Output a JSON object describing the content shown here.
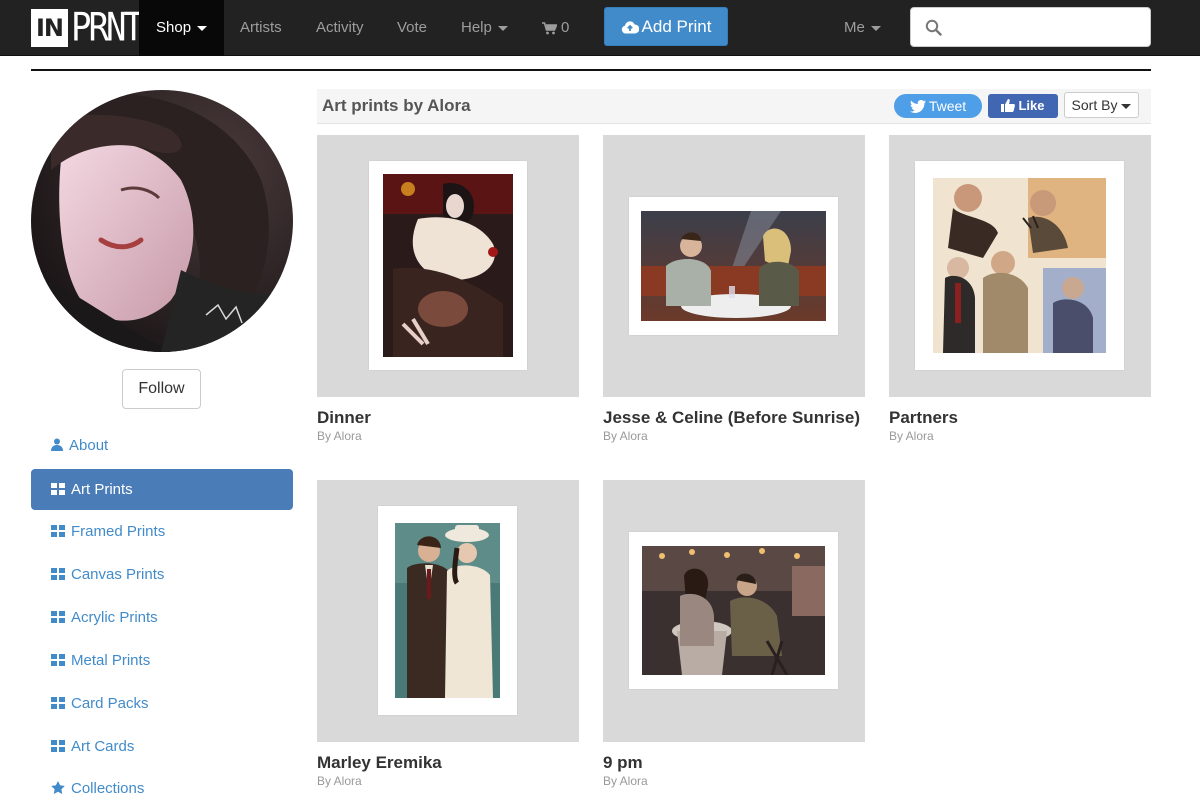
{
  "brand": {
    "logo_box": "IN",
    "logo_word": "PRNT"
  },
  "nav": {
    "shop": "Shop",
    "artists": "Artists",
    "activity": "Activity",
    "vote": "Vote",
    "help": "Help",
    "cart_count": "0",
    "add_print": "Add Print",
    "me": "Me",
    "search_placeholder": ""
  },
  "profile": {
    "follow": "Follow"
  },
  "sidebar": {
    "items": [
      {
        "label": "About",
        "icon": "user-icon",
        "active": false
      },
      {
        "label": "Art Prints",
        "icon": "grid-icon",
        "active": true
      },
      {
        "label": "Framed Prints",
        "icon": "grid-icon",
        "active": false
      },
      {
        "label": "Canvas Prints",
        "icon": "grid-icon",
        "active": false
      },
      {
        "label": "Acrylic Prints",
        "icon": "grid-icon",
        "active": false
      },
      {
        "label": "Metal Prints",
        "icon": "grid-icon",
        "active": false
      },
      {
        "label": "Card Packs",
        "icon": "grid-icon",
        "active": false
      },
      {
        "label": "Art Cards",
        "icon": "grid-icon",
        "active": false
      },
      {
        "label": "Collections",
        "icon": "star-icon",
        "active": false
      }
    ]
  },
  "main": {
    "title": "Art prints by Alora",
    "tweet": "Tweet",
    "like": "Like",
    "sort": "Sort By"
  },
  "prints": [
    {
      "title": "Dinner",
      "by": "By Alora"
    },
    {
      "title": "Jesse & Celine (Before Sunrise)",
      "by": "By Alora"
    },
    {
      "title": "Partners",
      "by": "By Alora"
    },
    {
      "title": "Marley Eremika",
      "by": "By Alora"
    },
    {
      "title": "9 pm",
      "by": "By Alora"
    }
  ],
  "colors": {
    "nav_bg": "#222222",
    "accent": "#428bca",
    "active_side": "#4a7db8",
    "thumb_bg": "#d9d9d9",
    "twitter": "#4f9ee8",
    "facebook": "#4267b2"
  }
}
